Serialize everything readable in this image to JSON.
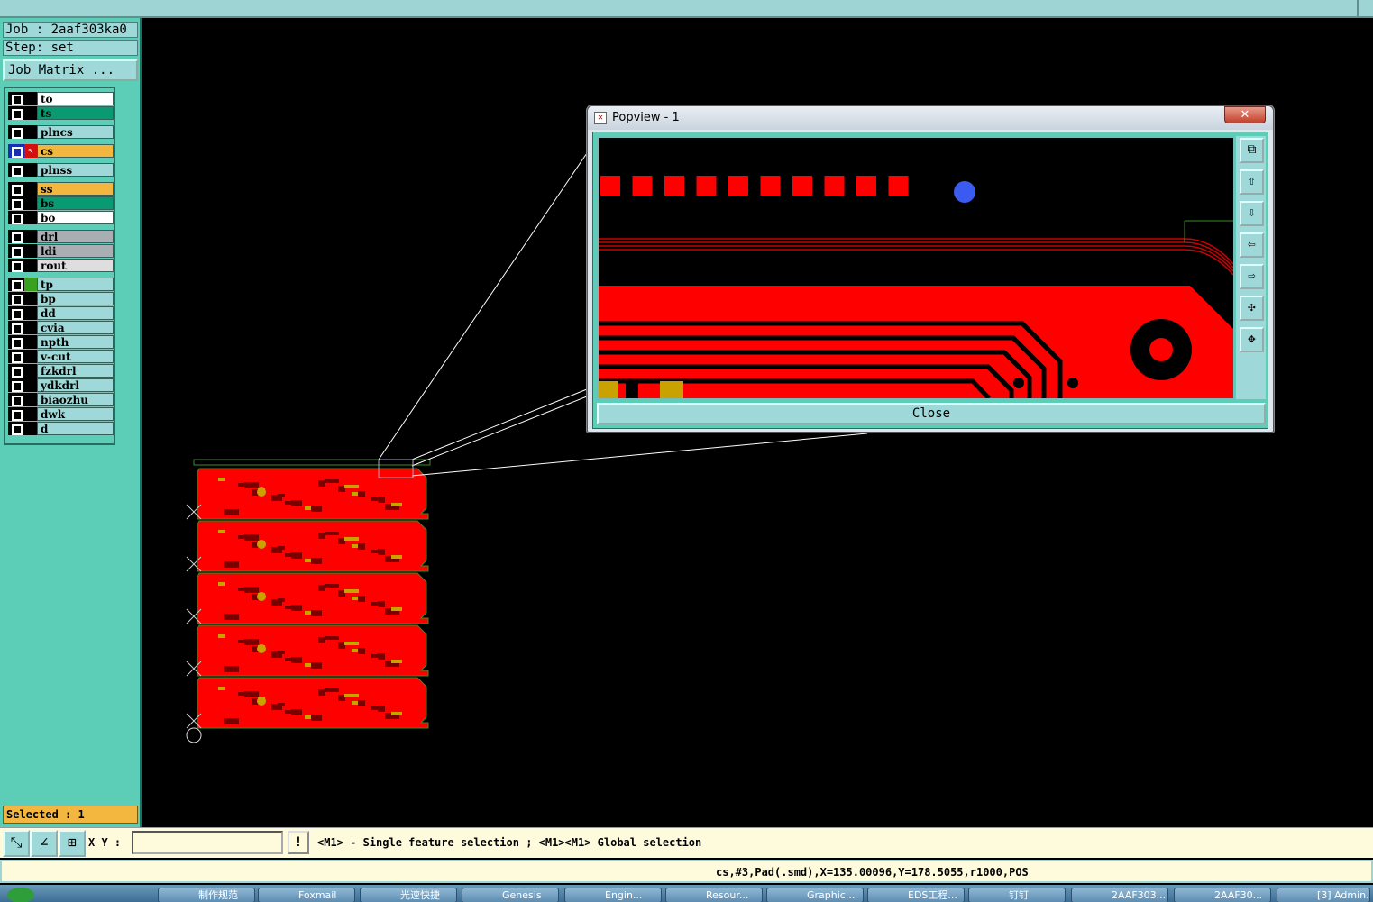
{
  "job": {
    "job_label": "Job : 2aaf303ka0",
    "step_label": "Step: set",
    "matrix_button": "Job Matrix ..."
  },
  "layers": [
    {
      "name": "to",
      "color": "#ffffff",
      "swatch": "#000000"
    },
    {
      "name": "ts",
      "color": "#0a9a72",
      "swatch": "#000000"
    },
    {
      "name": "plncs",
      "color": "#9fd8d8",
      "swatch": "#000000"
    },
    {
      "name": "cs",
      "color": "#f3b73f",
      "swatch": "#d21010",
      "active": true
    },
    {
      "name": "plnss",
      "color": "#9fd8d8",
      "swatch": "#000000"
    },
    {
      "name": "ss",
      "color": "#f3b73f",
      "swatch": "#000000"
    },
    {
      "name": "bs",
      "color": "#0a9a72",
      "swatch": "#000000"
    },
    {
      "name": "bo",
      "color": "#ffffff",
      "swatch": "#000000"
    },
    {
      "name": "drl",
      "color": "#a8aeb3",
      "swatch": "#000000"
    },
    {
      "name": "ldi",
      "color": "#a8aeb3",
      "swatch": "#000000"
    },
    {
      "name": "rout",
      "color": "#dedede",
      "swatch": "#000000"
    },
    {
      "name": "tp",
      "color": "#9fd8d8",
      "swatch": "#3aa020"
    },
    {
      "name": "bp",
      "color": "#9fd8d8",
      "swatch": "#000000"
    },
    {
      "name": "dd",
      "color": "#9fd8d8",
      "swatch": "#000000"
    },
    {
      "name": "cvia",
      "color": "#9fd8d8",
      "swatch": "#000000"
    },
    {
      "name": "npth",
      "color": "#9fd8d8",
      "swatch": "#000000"
    },
    {
      "name": "v-cut",
      "color": "#9fd8d8",
      "swatch": "#000000"
    },
    {
      "name": "fzkdrl",
      "color": "#9fd8d8",
      "swatch": "#000000"
    },
    {
      "name": "ydkdrl",
      "color": "#9fd8d8",
      "swatch": "#000000"
    },
    {
      "name": "biaozhu",
      "color": "#9fd8d8",
      "swatch": "#000000"
    },
    {
      "name": "dwk",
      "color": "#9fd8d8",
      "swatch": "#000000"
    },
    {
      "name": "d",
      "color": "#9fd8d8",
      "swatch": "#000000"
    }
  ],
  "selected_label": "Selected : 1",
  "popview": {
    "title": "Popview - 1",
    "close_label": "Close",
    "close_x": "✕"
  },
  "cmdbar": {
    "xy_label": "X Y :",
    "xy_value": "",
    "bang": "!",
    "hint": "<M1> - Single feature selection ; <M1><M1> Global selection"
  },
  "status": "cs,#3,Pad(.smd),X=135.00096,Y=178.5055,r1000,POS",
  "taskbar": [
    "制作规范",
    "Foxmail",
    "光速快捷",
    "Genesis",
    "Engin...",
    "Resour...",
    "Graphic...",
    "EDS工程...",
    "钉钉",
    "2AAF303...",
    "2AAF30...",
    "[3] Admin..."
  ],
  "colors": {
    "copper": "#ff0000",
    "panel": "#5ccdb6",
    "button": "#9fd8d8",
    "highlight": "#f3b73f"
  }
}
